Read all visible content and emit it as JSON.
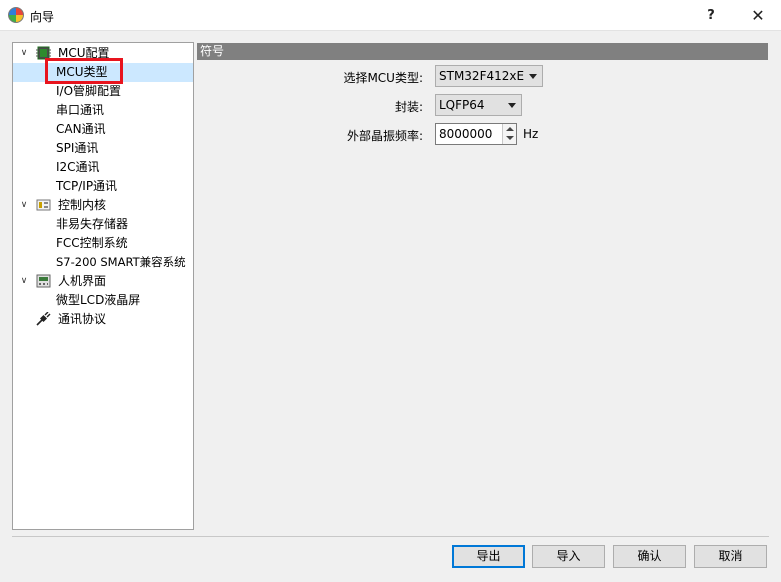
{
  "window": {
    "title": "向导",
    "help_label": "?",
    "close_label": "✕"
  },
  "tree": {
    "items": [
      {
        "label": "MCU配置",
        "level": 0,
        "expanded": true,
        "icon": "chip-icon"
      },
      {
        "label": "MCU类型",
        "level": 1,
        "selected": true
      },
      {
        "label": "I/O管脚配置",
        "level": 1
      },
      {
        "label": "串口通讯",
        "level": 1
      },
      {
        "label": "CAN通讯",
        "level": 1
      },
      {
        "label": "SPI通讯",
        "level": 1
      },
      {
        "label": "I2C通讯",
        "level": 1
      },
      {
        "label": "TCP/IP通讯",
        "level": 1
      },
      {
        "label": "控制内核",
        "level": 0,
        "expanded": true,
        "icon": "control-core-icon"
      },
      {
        "label": "非易失存储器",
        "level": 1
      },
      {
        "label": "FCC控制系统",
        "level": 1
      },
      {
        "label": "S7-200 SMART兼容系统",
        "level": 1
      },
      {
        "label": "人机界面",
        "level": 0,
        "expanded": true,
        "icon": "hmi-panel-icon"
      },
      {
        "label": "微型LCD液晶屏",
        "level": 1
      },
      {
        "label": "通讯协议",
        "level": 0,
        "expanded": false,
        "icon": "plug-icon"
      }
    ]
  },
  "panel": {
    "header": "符号",
    "mcu_type_label": "选择MCU类型:",
    "mcu_type_value": "STM32F412xE",
    "package_label": "封装:",
    "package_value": "LQFP64",
    "crystal_label": "外部晶振频率:",
    "crystal_value": "8000000",
    "crystal_unit": "Hz"
  },
  "buttons": {
    "export": "导出",
    "import": "导入",
    "ok": "确认",
    "cancel": "取消"
  },
  "colors": {
    "selection": "#cce8ff",
    "highlight_box": "#e8141e",
    "panel_header": "#808080",
    "default_button_border": "#0078d7"
  }
}
